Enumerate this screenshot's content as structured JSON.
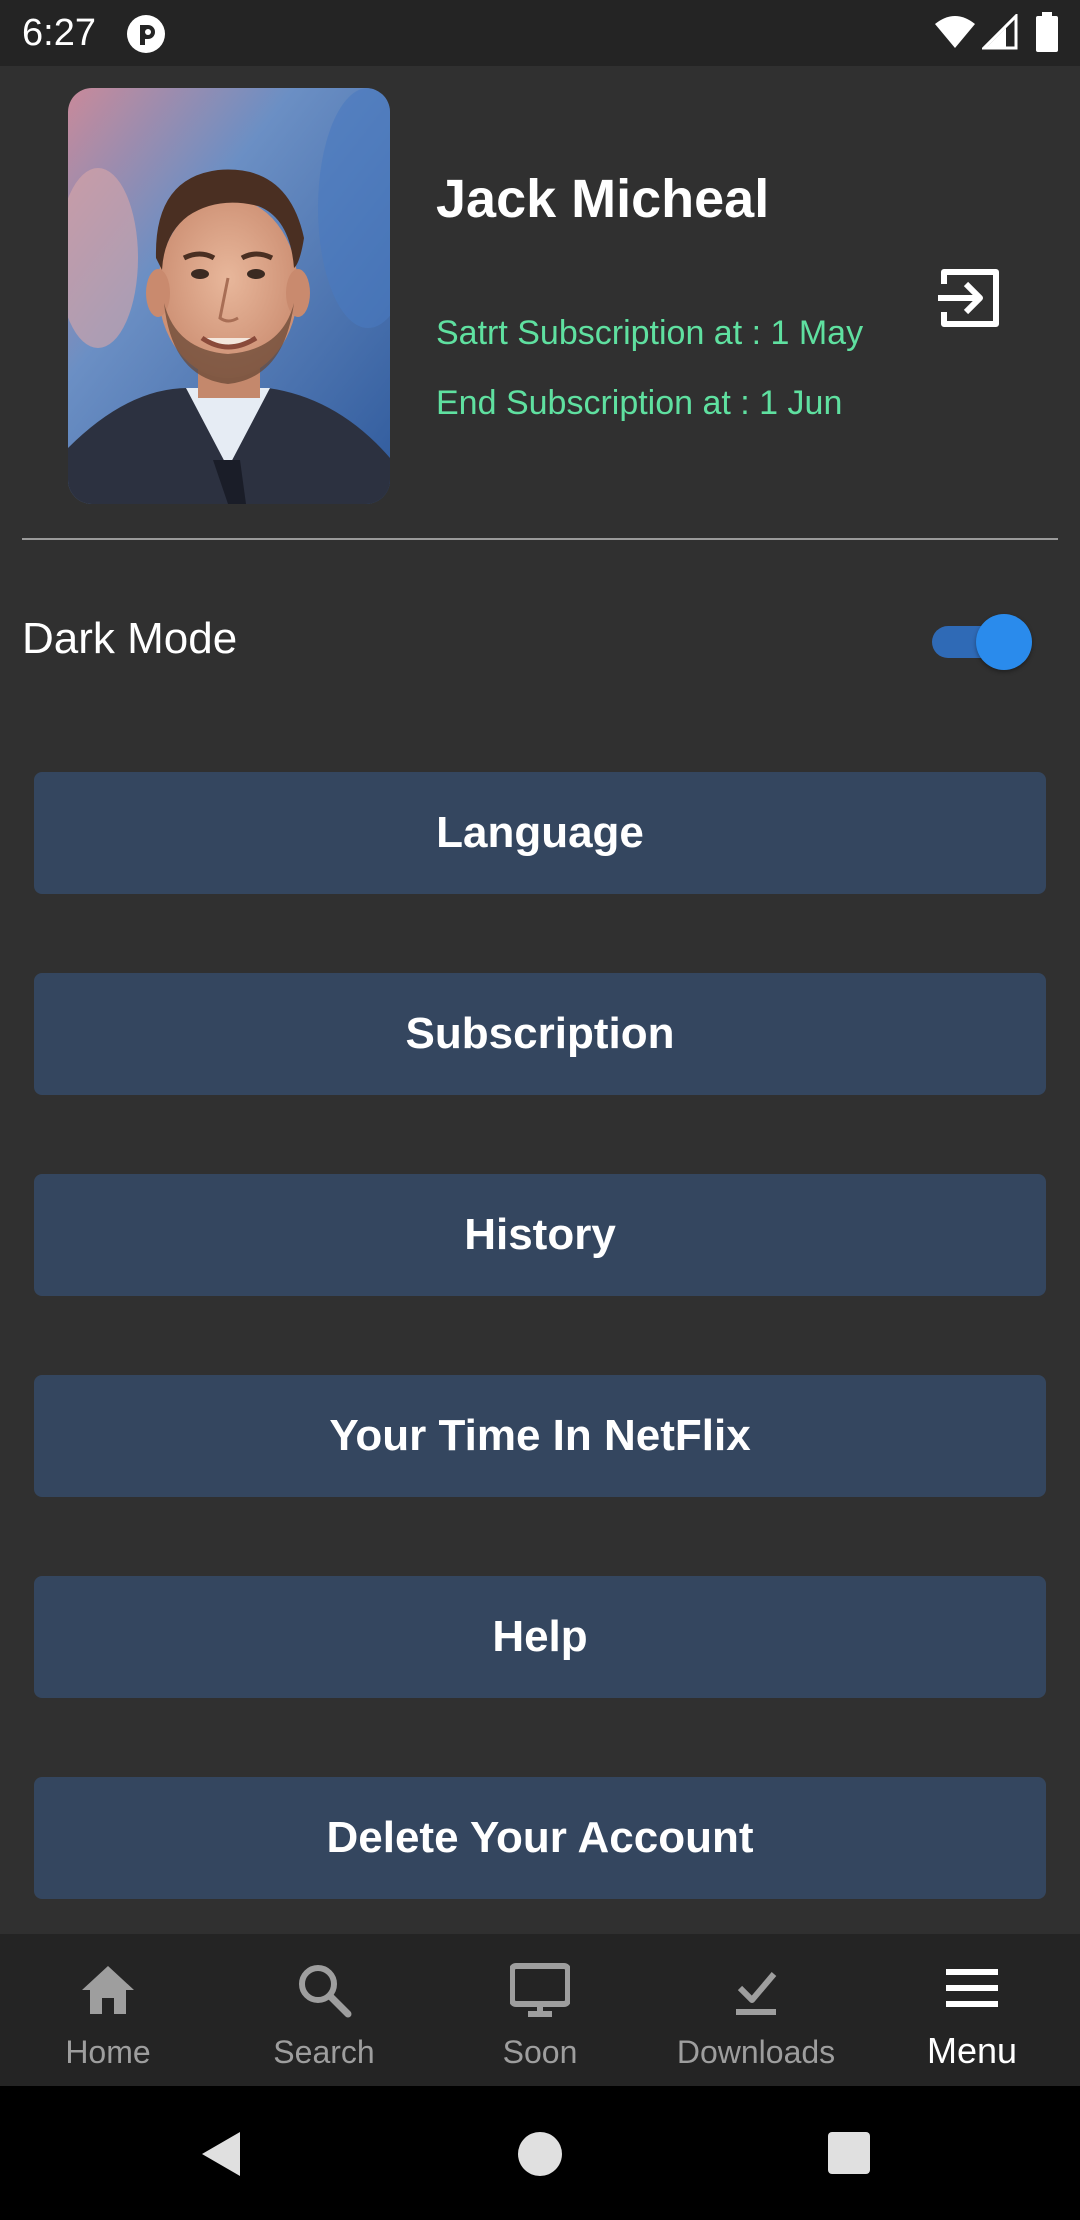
{
  "status_bar": {
    "time": "6:27"
  },
  "profile": {
    "name": "Jack Micheal",
    "subscription_start": "Satrt Subscription at : 1 May",
    "subscription_end": "End Subscription at : 1 Jun"
  },
  "settings": {
    "dark_mode_label": "Dark Mode",
    "dark_mode_on": true
  },
  "menu": {
    "language": "Language",
    "subscription": "Subscription",
    "history": "History",
    "time_in_netflix": "Your Time In NetFlix",
    "help": "Help",
    "delete_account": "Delete Your Account"
  },
  "bottom_nav": {
    "home": "Home",
    "search": "Search",
    "soon": "Soon",
    "downloads": "Downloads",
    "menu": "Menu",
    "active": "menu"
  },
  "colors": {
    "background": "#303030",
    "bar": "#242424",
    "button": "#34465f",
    "accent_green": "#5fe0a0",
    "toggle_blue": "#2a8bec"
  }
}
